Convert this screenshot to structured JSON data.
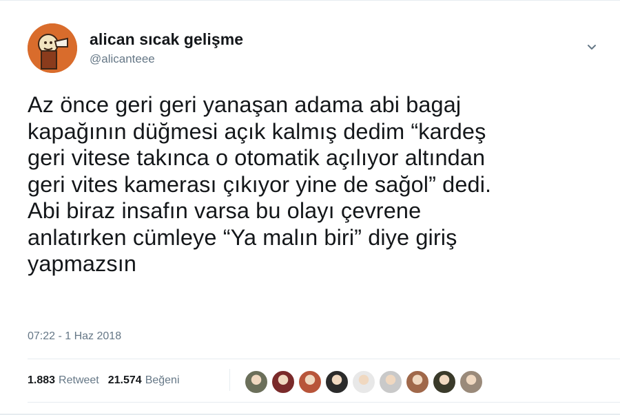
{
  "tweet": {
    "display_name": "alican sıcak gelişme",
    "handle": "@alicanteee",
    "text": "Az önce geri geri yanaşan adama abi bagaj\nkapağının düğmesi açık kalmış dedim “kardeş\ngeri vitese takınca o otomatik açılıyor altından\ngeri vites kamerası çıkıyor yine de sağol” dedi.\nAbi biraz insafın varsa bu olayı çevrene\nanlatırken cümleye “Ya malın biri” diye giriş\nyapmazsın",
    "timestamp": "07:22 - 1 Haz 2018"
  },
  "stats": {
    "retweets_count": "1.883",
    "retweets_label": "Retweet",
    "likes_count": "21.574",
    "likes_label": "Beğeni"
  },
  "icons": {
    "menu": "chevron-down-icon",
    "avatar": "avatar"
  },
  "likers": [
    {
      "name": "liker-avatar-1",
      "color": "#6b6f5a"
    },
    {
      "name": "liker-avatar-2",
      "color": "#7a2a2a"
    },
    {
      "name": "liker-avatar-3",
      "color": "#b8553a"
    },
    {
      "name": "liker-avatar-4",
      "color": "#2b2b2b"
    },
    {
      "name": "liker-avatar-5",
      "color": "#e8e8e8"
    },
    {
      "name": "liker-avatar-6",
      "color": "#c9c9c9"
    },
    {
      "name": "liker-avatar-7",
      "color": "#a0684a"
    },
    {
      "name": "liker-avatar-8",
      "color": "#3a3a2a"
    },
    {
      "name": "liker-avatar-9",
      "color": "#9a8a7a"
    }
  ],
  "colors": {
    "text": "#14171a",
    "secondary": "#657786",
    "divider": "#e6ecf0",
    "avatar_bg": "#d96c2c"
  }
}
